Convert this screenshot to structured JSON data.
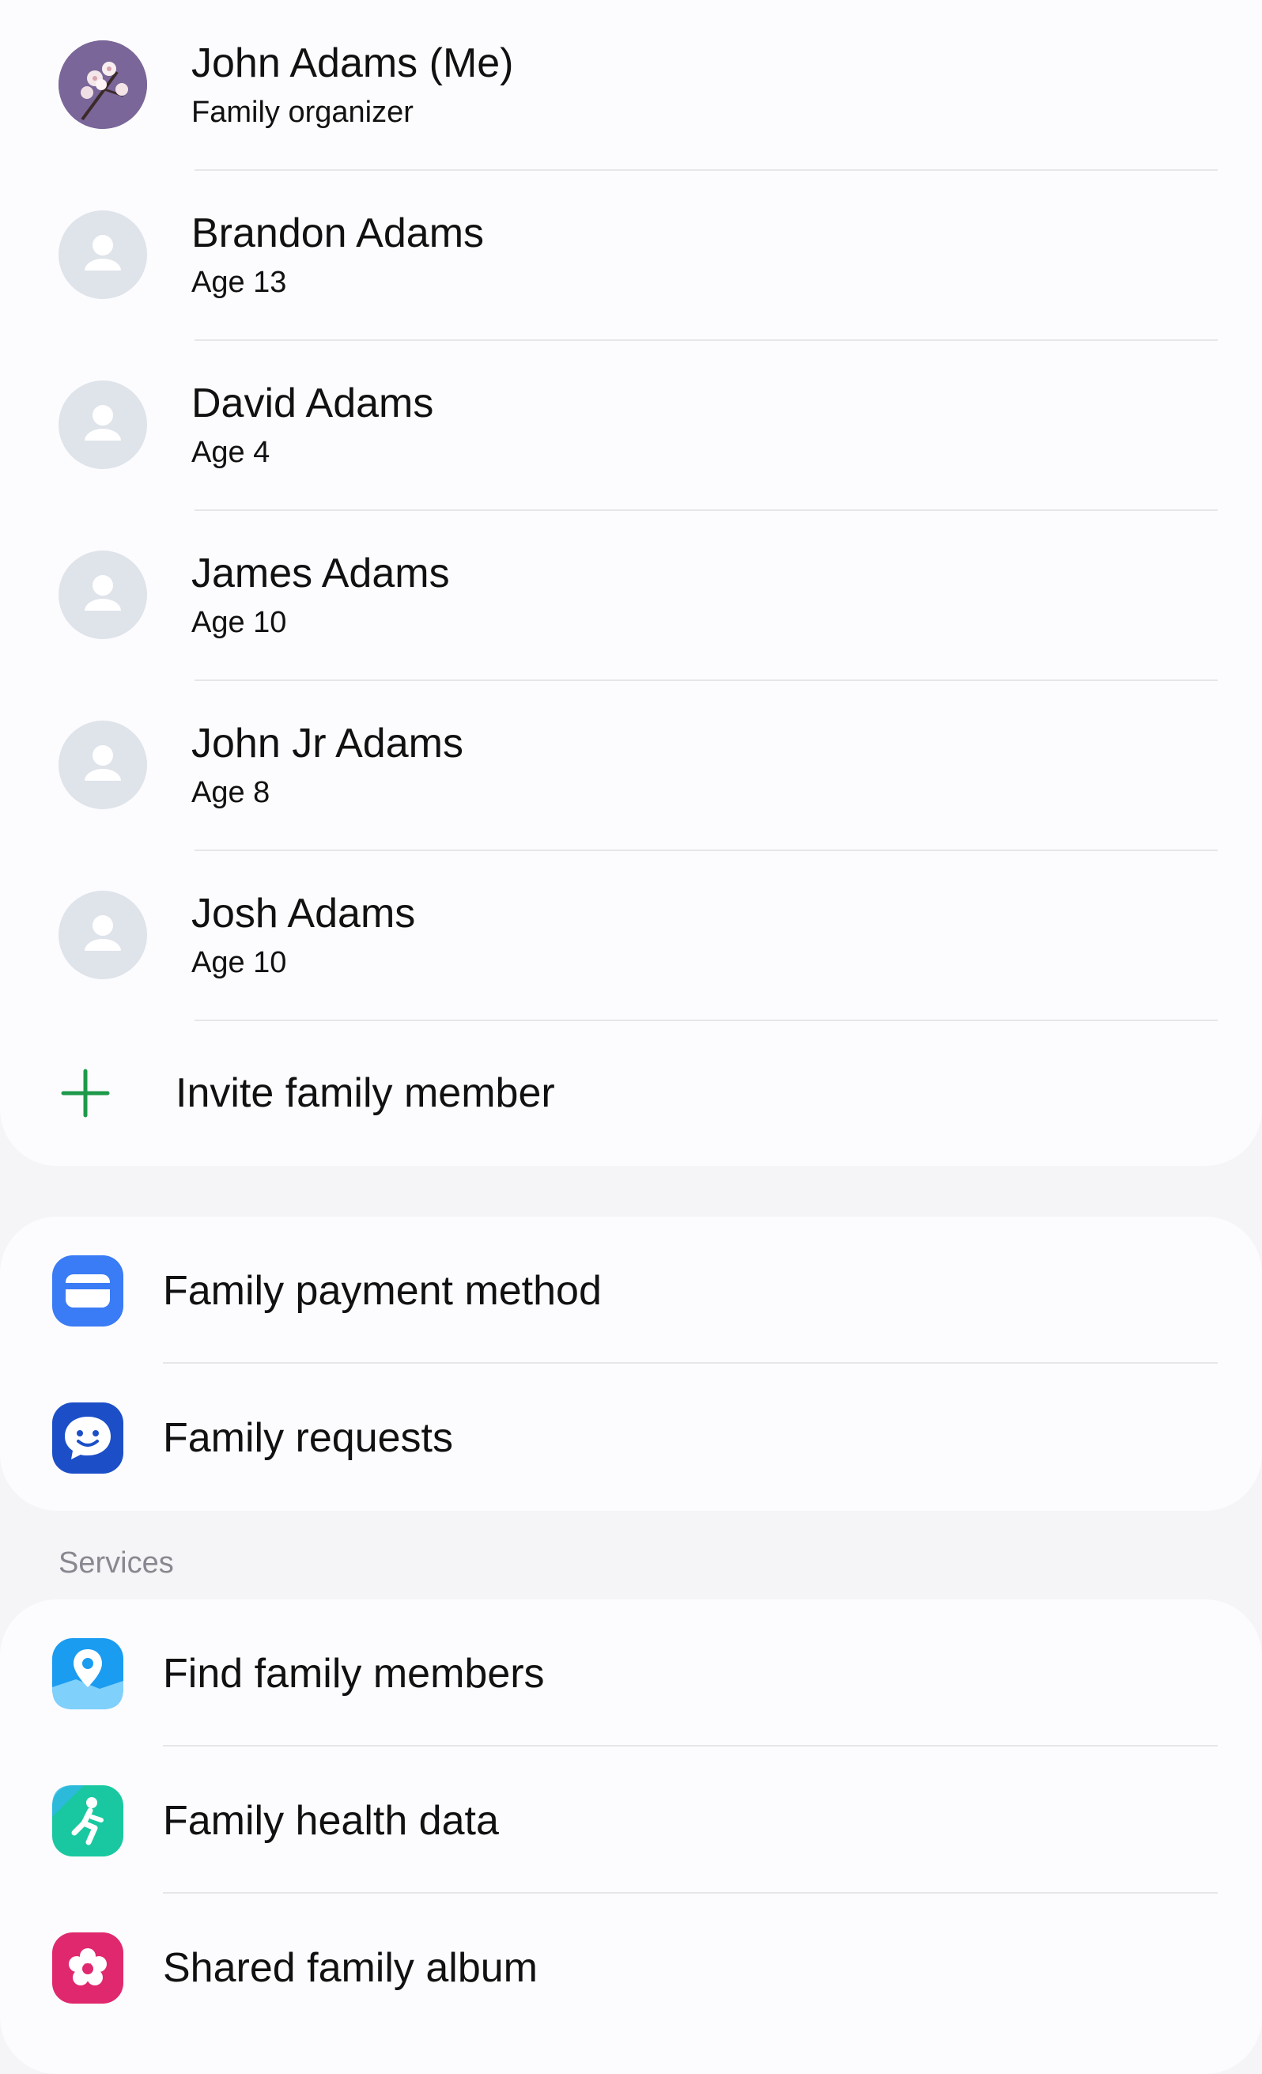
{
  "members": [
    {
      "name": "John Adams (Me)",
      "subtitle": "Family organizer",
      "avatar": "photo-avatar-flowers"
    },
    {
      "name": "Brandon Adams",
      "subtitle": "Age 13",
      "avatar": "default-person-avatar"
    },
    {
      "name": "David Adams",
      "subtitle": "Age 4",
      "avatar": "default-person-avatar"
    },
    {
      "name": "James Adams",
      "subtitle": "Age 10",
      "avatar": "default-person-avatar"
    },
    {
      "name": "John Jr Adams",
      "subtitle": "Age 8",
      "avatar": "default-person-avatar"
    },
    {
      "name": "Josh Adams",
      "subtitle": "Age 10",
      "avatar": "default-person-avatar"
    }
  ],
  "invite": {
    "label": "Invite family member",
    "icon": "plus-icon",
    "color": "#1e9a4a"
  },
  "family_items": [
    {
      "label": "Family payment method",
      "icon": "card-icon",
      "color": "#3a7bf6"
    },
    {
      "label": "Family requests",
      "icon": "chat-smile-icon",
      "color": "#1c4fc7"
    }
  ],
  "services": {
    "header": "Services",
    "items": [
      {
        "label": "Find family members",
        "icon": "location-pin-icon",
        "color": "#1a9cf0"
      },
      {
        "label": "Family health data",
        "icon": "health-figure-icon",
        "color": "#19c8a0"
      },
      {
        "label": "Shared family album",
        "icon": "flower-album-icon",
        "color": "#e0286e"
      }
    ]
  }
}
